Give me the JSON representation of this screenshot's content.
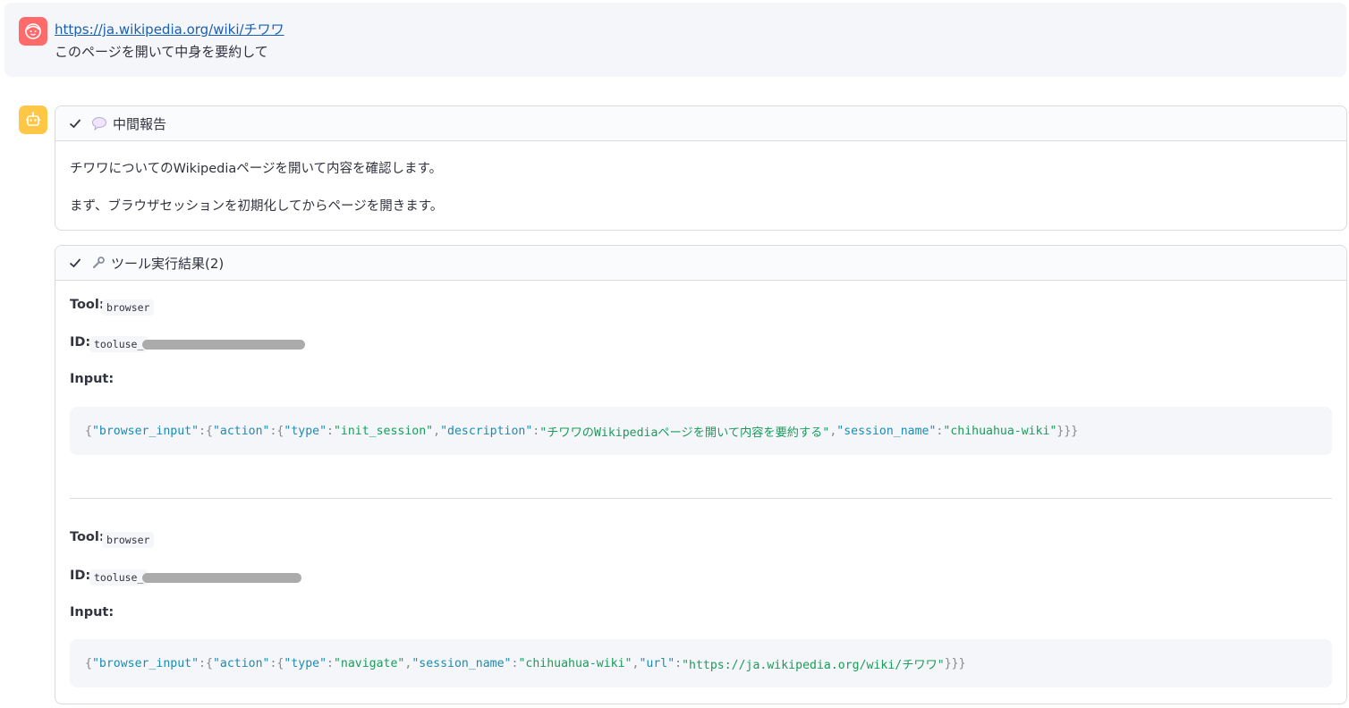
{
  "user_message": {
    "link": "https://ja.wikipedia.org/wiki/チワワ",
    "text": "このページを開いて中身を要約して"
  },
  "progress_report": {
    "title": "中間報告",
    "lines": [
      "チワワについてのWikipediaページを開いて内容を確認します。",
      "まず、ブラウザセッションを初期化してからページを開きます。"
    ]
  },
  "tool_results": {
    "title": "ツール実行結果(2)",
    "labels": {
      "tool": "Tool:",
      "id": "ID:",
      "input": "Input:"
    },
    "items": [
      {
        "tool": "browser",
        "id": "tooluse_",
        "input_key": "\"browser_input\"",
        "action_key": "\"action\"",
        "fields": [
          [
            "\"type\"",
            "\"init_session\""
          ],
          [
            "\"description\"",
            "\"チワワのWikipediaページを開いて内容を要約する\""
          ],
          [
            "\"session_name\"",
            "\"chihuahua-wiki\""
          ]
        ]
      },
      {
        "tool": "browser",
        "id": "tooluse_",
        "input_key": "\"browser_input\"",
        "action_key": "\"action\"",
        "fields": [
          [
            "\"type\"",
            "\"navigate\""
          ],
          [
            "\"session_name\"",
            "\"chihuahua-wiki\""
          ],
          [
            "\"url\"",
            "\"https://ja.wikipedia.org/wiki/チワワ\""
          ]
        ]
      }
    ]
  },
  "colors": {
    "user_avatar": "#ff6b6b",
    "bot_avatar": "#ffc745",
    "json_key": "#1c8bb3",
    "json_string": "#1a9c5b"
  },
  "icons": {
    "user": "user-face-icon",
    "bot": "robot-icon",
    "check": "checkmark-icon",
    "speech": "speech-bubble-icon",
    "wrench": "wrench-icon"
  }
}
